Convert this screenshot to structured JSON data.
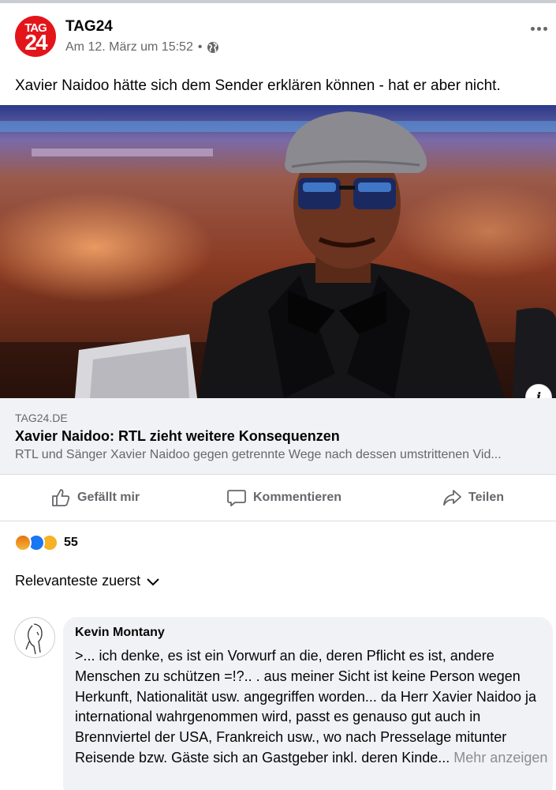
{
  "post": {
    "page_name": "TAG24",
    "logo_top": "TAG",
    "logo_bottom": "24",
    "timestamp": "Am 12. März um 15:52",
    "separator": "•",
    "text": "Xavier Naidoo hätte sich dem Sender erklären können - hat er aber nicht."
  },
  "link": {
    "domain": "TAG24.DE",
    "title": "Xavier Naidoo: RTL zieht weitere Konsequenzen",
    "description": "RTL und Sänger Xavier Naidoo gegen getrennte Wege nach dessen umstrittenen Vid..."
  },
  "info_label": "i",
  "actions": {
    "like": "Gefällt mir",
    "comment": "Kommentieren",
    "share": "Teilen"
  },
  "reactions": {
    "icons": [
      "angry-icon",
      "like-icon",
      "haha-icon"
    ],
    "count": "55"
  },
  "sort_label": "Relevanteste zuerst",
  "comment": {
    "author": "Kevin Montany",
    "text": ">... ich denke, es ist ein Vorwurf an die, deren Pflicht es ist, andere Menschen zu schützen =!?.. . aus meiner Sicht ist keine Person wegen Herkunft, Nationalität usw. angegriffen worden... da Herr Xavier Naidoo ja international wahrgenommen wird, passt es genauso gut auch in Brennviertel der USA, Frankreich usw., wo nach Presselage mitunter Reisende bzw. Gäste sich an Gastgeber inkl. deren Kinde...",
    "more": "Mehr anzeigen"
  },
  "colors": {
    "brand_red": "#e3151a",
    "secondary_text": "#65676b",
    "link_bg": "#f0f2f5",
    "like_blue": "#1877f2"
  }
}
